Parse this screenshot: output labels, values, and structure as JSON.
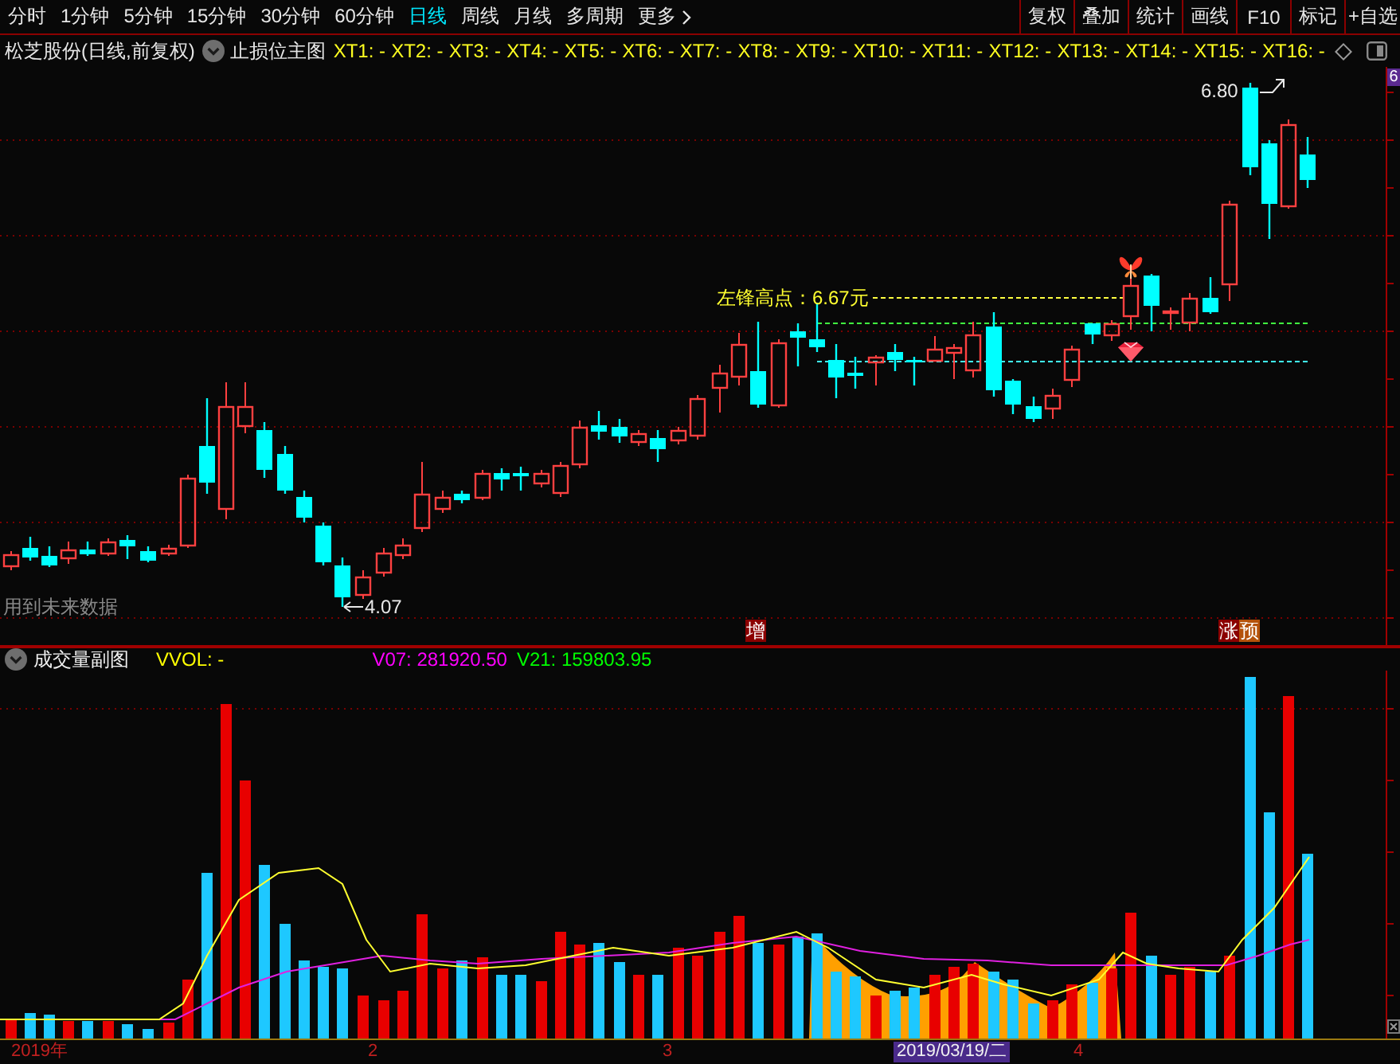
{
  "toolbar": {
    "periods": [
      {
        "label": "分时",
        "kind": "period",
        "selected": false
      },
      {
        "label": "1分钟",
        "kind": "period",
        "selected": false
      },
      {
        "label": "5分钟",
        "kind": "period",
        "selected": false
      },
      {
        "label": "15分钟",
        "kind": "period",
        "selected": false
      },
      {
        "label": "30分钟",
        "kind": "period",
        "selected": false
      },
      {
        "label": "60分钟",
        "kind": "period",
        "selected": false
      },
      {
        "label": "日线",
        "kind": "period",
        "selected": true
      },
      {
        "label": "周线",
        "kind": "period",
        "selected": false
      },
      {
        "label": "月线",
        "kind": "period",
        "selected": false
      },
      {
        "label": "多周期",
        "kind": "period",
        "selected": false
      },
      {
        "label": "更多",
        "kind": "menu",
        "selected": false
      }
    ],
    "actions": [
      "复权",
      "叠加",
      "统计",
      "画线",
      "F10",
      "标记",
      "+自选"
    ]
  },
  "main_chart": {
    "title": "松芝股份(日线,前复权)",
    "indicator": "止损位主图",
    "indicator_values": [
      "XT1: -",
      "XT2: -",
      "XT3: -",
      "XT4: -",
      "XT5: -",
      "XT6: -",
      "XT7: -",
      "XT8: -",
      "XT9: -",
      "XT10: -",
      "XT11: -",
      "XT12: -",
      "XT13: -",
      "XT14: -",
      "XT15: -",
      "XT16: -"
    ],
    "price_label": "6",
    "high_point_label": "左锋高点：6.67元",
    "high_price": "6.80",
    "low_price": "4.07",
    "warning": "用到未来数据",
    "signals": [
      {
        "text": "增",
        "color": "#8b0000"
      },
      {
        "text": "涨",
        "color": "#8b0000"
      },
      {
        "text": "预",
        "color": "#b4520a"
      }
    ]
  },
  "volume_chart": {
    "title": "成交量副图",
    "values": [
      {
        "label": "VVOL: -",
        "color": "#ffff00"
      },
      {
        "label": "V07: 281920.50",
        "color": "#ff00ff"
      },
      {
        "label": "V21: 159803.95",
        "color": "#00ff00"
      }
    ]
  },
  "time_axis": [
    {
      "label": "2019年",
      "selected": false
    },
    {
      "label": "2",
      "selected": false
    },
    {
      "label": "3",
      "selected": false
    },
    {
      "label": "2019/03/19/二",
      "selected": true
    },
    {
      "label": "4",
      "selected": false
    }
  ]
}
